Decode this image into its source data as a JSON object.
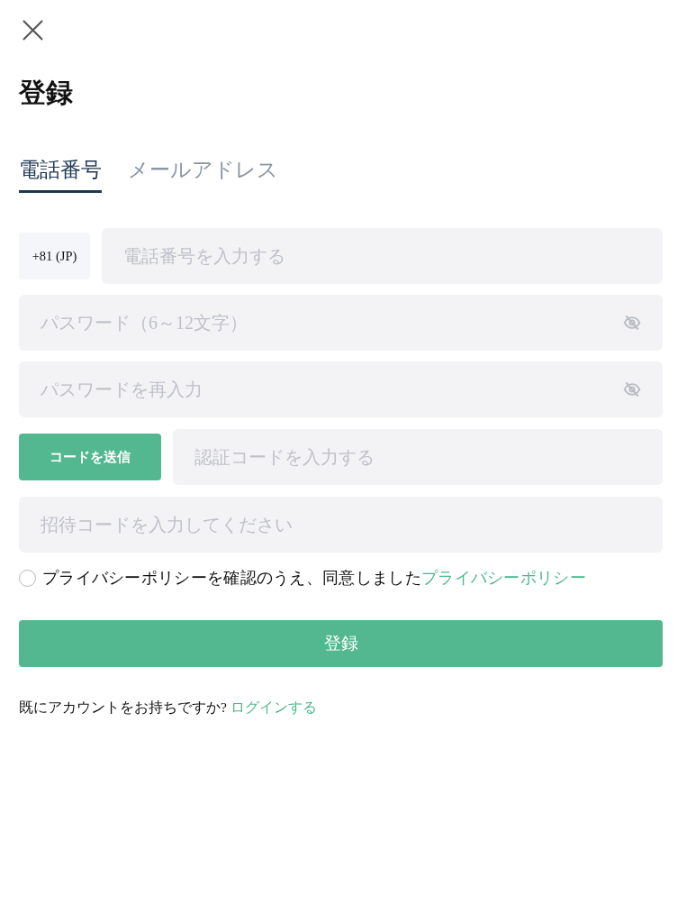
{
  "title": "登録",
  "tabs": [
    {
      "label": "電話番号",
      "selected": true
    },
    {
      "label": "メールアドレス",
      "selected": false
    }
  ],
  "phone": {
    "country_code": "+81 (JP)",
    "placeholder": "電話番号を入力する"
  },
  "password_fields": [
    {
      "placeholder": "パスワード（6～12文字）"
    },
    {
      "placeholder": "パスワードを再入力"
    }
  ],
  "verification": {
    "button": "コードを送信",
    "placeholder": "認証コードを入力する"
  },
  "invite": {
    "placeholder": "招待コードを入力してください"
  },
  "agreement": {
    "checked": false,
    "text": "プライバシーポリシーを確認のうえ、同意しました",
    "link": "プライバシーポリシー"
  },
  "submit_button": "登録",
  "login_prompt": {
    "text": "既にアカウントをお持ちですか?",
    "link": "ログインする"
  }
}
